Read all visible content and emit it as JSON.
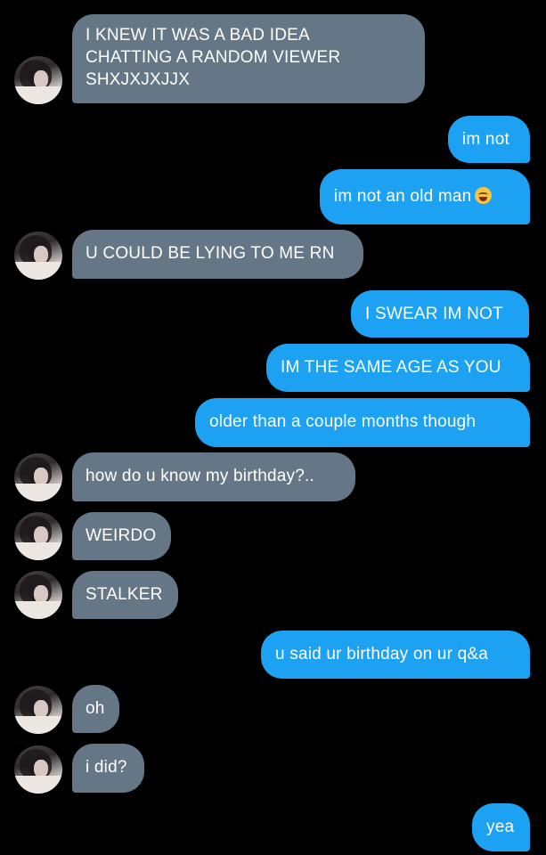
{
  "messages": [
    {
      "sender": "them",
      "text": "I KNEW IT WAS A BAD IDEA\nCHATTING A RANDOM VIEWER\nSHXJXJXJJX"
    },
    {
      "sender": "me",
      "text": "im not"
    },
    {
      "sender": "me",
      "text": "im not an old man",
      "emoji": "loudly-crying-face"
    },
    {
      "sender": "them",
      "text": "U COULD BE LYING TO ME RN"
    },
    {
      "sender": "me",
      "text": "I SWEAR IM NOT"
    },
    {
      "sender": "me",
      "text": "IM THE SAME AGE AS YOU"
    },
    {
      "sender": "me",
      "text": "older than a couple months though"
    },
    {
      "sender": "them",
      "text": "how do u know my birthday?.."
    },
    {
      "sender": "them",
      "text": "WEIRDO"
    },
    {
      "sender": "them",
      "text": "STALKER"
    },
    {
      "sender": "me",
      "text": "u said ur birthday on ur q&a"
    },
    {
      "sender": "them",
      "text": "oh"
    },
    {
      "sender": "them",
      "text": "i did?"
    },
    {
      "sender": "me",
      "text": "yea"
    }
  ],
  "colors": {
    "background": "#000000",
    "their_bubble": "#657786",
    "my_bubble": "#1da1f2",
    "text": "#ffffff"
  }
}
